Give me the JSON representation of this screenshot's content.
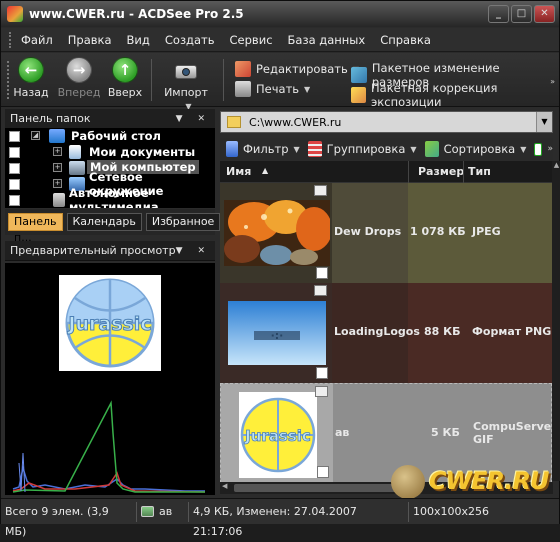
{
  "window": {
    "title": "www.CWER.ru - ACDSee Pro 2.5"
  },
  "menu": [
    "Файл",
    "Правка",
    "Вид",
    "Создать",
    "Сервис",
    "База данных",
    "Справка"
  ],
  "toolbar": {
    "back": "Назад",
    "forward": "Вперед",
    "up": "Вверх",
    "import": "Импорт",
    "edit": "Редактировать",
    "print": "Печать",
    "batch_resize": "Пакетное изменение размеров",
    "batch_exposure": "Пакетная коррекция экспозиции"
  },
  "folders_panel": {
    "title": "Панель папок",
    "items": [
      {
        "label": "Рабочий стол",
        "icon": "desktop-icon"
      },
      {
        "label": "Мои документы",
        "icon": "documents-icon"
      },
      {
        "label": "Мой компьютер",
        "icon": "computer-icon"
      },
      {
        "label": "Сетевое окружение",
        "icon": "network-icon"
      },
      {
        "label": "Автономное мультимедиа",
        "icon": "media-icon"
      }
    ]
  },
  "tabs": [
    "Панель п...",
    "Календарь",
    "Избранное"
  ],
  "preview": {
    "title": "Предварительный просмотр",
    "logo_text": "Jurassic"
  },
  "path": {
    "value": "C:\\www.CWER.ru"
  },
  "filter_bar": {
    "filter": "Фильтр",
    "group": "Группировка",
    "sort": "Сортировка"
  },
  "file_list": {
    "columns": [
      "Имя",
      "Размер",
      "Тип"
    ],
    "rows": [
      {
        "name": "Dew Drops",
        "size": "1 078 КБ",
        "type": "JPEG"
      },
      {
        "name": "LoadingLogos",
        "size": "88 КБ",
        "type": "Формат PNG"
      },
      {
        "name": "ав",
        "size": "5 КБ",
        "type": "CompuServe GIF"
      }
    ]
  },
  "status": {
    "total": "Всего 9 элем.  (3,9 МБ)",
    "selected_name": "ав",
    "details": "4,9 КБ, Изменен: 27.04.2007 21:17:06",
    "dims": "100x100x256"
  },
  "watermark": "CWER.RU",
  "colors": {
    "accent_tab": "#f0b75a",
    "row1_bg": "#5a5440",
    "row2_bg": "#4a3028",
    "row3_bg": "#8a8a8a"
  }
}
